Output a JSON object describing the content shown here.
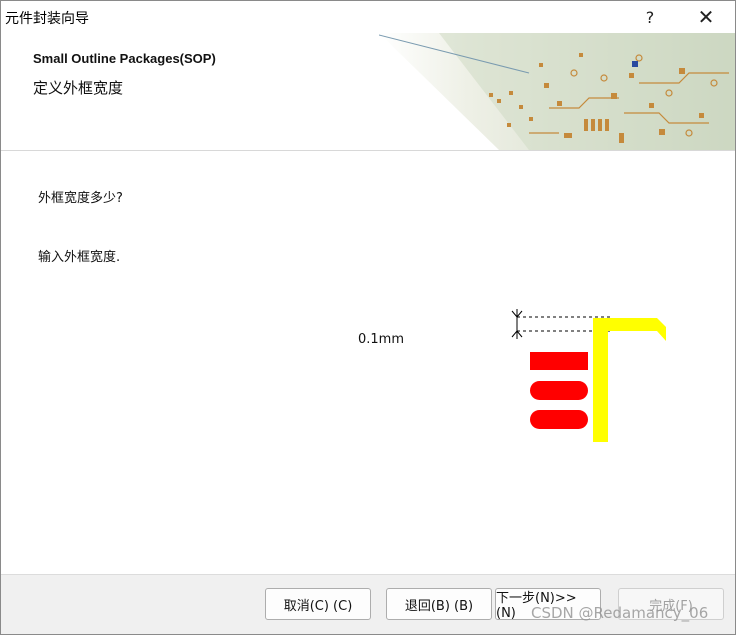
{
  "window": {
    "title": "元件封装向导",
    "help_label": "?",
    "close_label": "✕"
  },
  "header": {
    "title": "Small Outline Packages(SOP)",
    "subtitle": "定义外框宽度"
  },
  "content": {
    "question": "外框宽度多少?",
    "instruction": "输入外框宽度.",
    "outline_width_value": "0.1mm"
  },
  "preview": {
    "outline_color": "#ffff00",
    "pad_color": "#ff0000",
    "dimension_color": "#000000"
  },
  "buttons": {
    "cancel": "取消(C) (C)",
    "back": "退回(B) (B)",
    "next": "下一步(N)>> (N)",
    "finish": "完成(F)"
  },
  "watermark": "CSDN @Redamancy_06"
}
